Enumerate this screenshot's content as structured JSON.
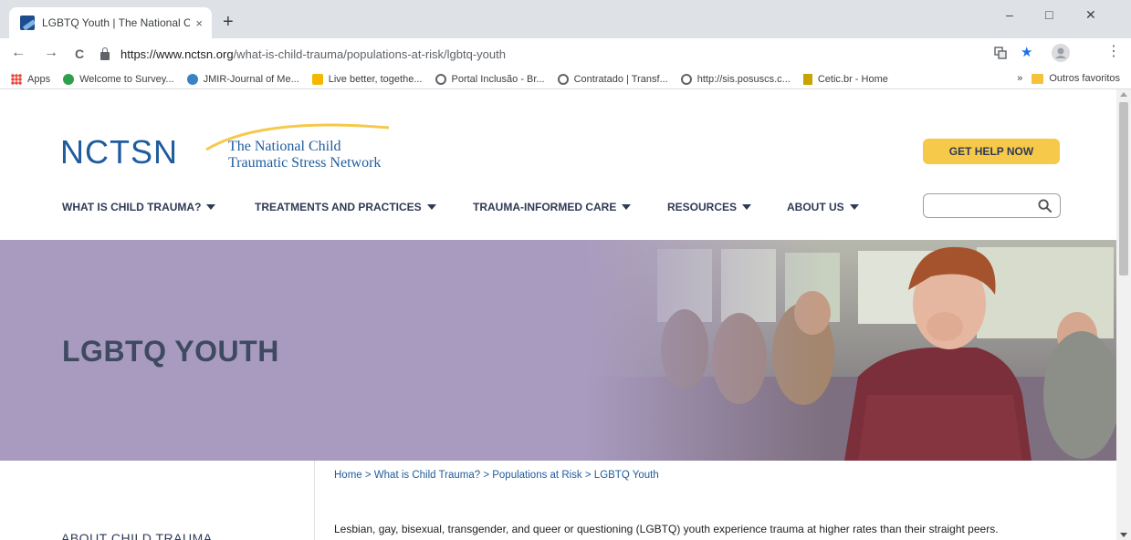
{
  "browser": {
    "tab_title": "LGBTQ Youth | The National Child",
    "tab_close": "×",
    "new_tab": "+",
    "win_min": "–",
    "win_max": "□",
    "win_close": "✕",
    "back": "←",
    "forward": "→",
    "reload": "C",
    "url_host": "https://www.nctsn.org",
    "url_path": "/what-is-child-trauma/populations-at-risk/lgbtq-youth",
    "star": "★",
    "menu": "⋮",
    "bookmarks": [
      {
        "label": "Apps",
        "icon": "apps-icon"
      },
      {
        "label": "Welcome to Survey...",
        "icon": "survey-icon"
      },
      {
        "label": "JMIR-Journal of Me...",
        "icon": "jmir-icon"
      },
      {
        "label": "Live better, togethe...",
        "icon": "bookmark-icon"
      },
      {
        "label": "Portal Inclusão - Br...",
        "icon": "globe-icon"
      },
      {
        "label": "Contratado | Transf...",
        "icon": "globe-icon"
      },
      {
        "label": "http://sis.posuscs.c...",
        "icon": "globe-icon"
      },
      {
        "label": "Cetic.br - Home",
        "icon": "cetic-icon"
      }
    ],
    "bookmarks_more": "»",
    "other_bookmarks": "Outros favoritos"
  },
  "site": {
    "logo_mark": "NCTSN",
    "logo_line1": "The National Child",
    "logo_line2": "Traumatic Stress Network",
    "get_help": "GET HELP NOW",
    "nav": [
      "WHAT IS CHILD TRAUMA?",
      "TREATMENTS AND PRACTICES",
      "TRAUMA-INFORMED CARE",
      "RESOURCES",
      "ABOUT US"
    ],
    "search_placeholder": "",
    "hero_title": "LGBTQ YOUTH",
    "breadcrumb": [
      "Home",
      "What is Child Trauma?",
      "Populations at Risk",
      "LGBTQ Youth"
    ],
    "breadcrumb_sep": " > ",
    "sidebar_heading": "ABOUT CHILD TRAUMA",
    "intro": "Lesbian, gay, bisexual, transgender, and queer or questioning (LGBTQ) youth experience trauma at higher rates than their straight peers."
  },
  "colors": {
    "brand_blue": "#1f5c9e",
    "accent_yellow": "#f6c94b",
    "hero_purple": "#a99bbf",
    "nav_text": "#2f3a55"
  }
}
